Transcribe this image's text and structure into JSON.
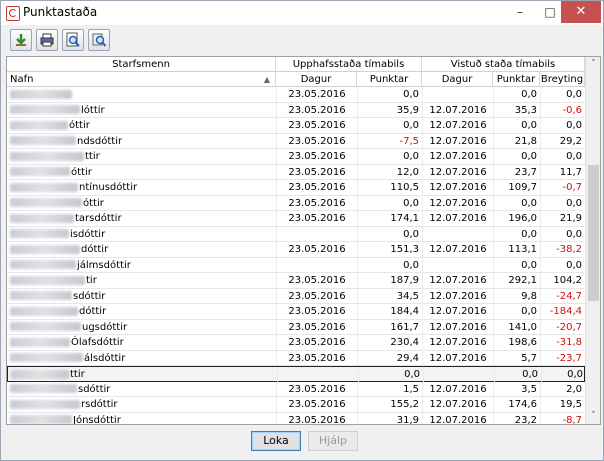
{
  "window": {
    "title": "Punktastaða"
  },
  "toolbar": {
    "tools": [
      {
        "name": "download-tool",
        "icon": "download-arrow-icon"
      },
      {
        "name": "print-tool",
        "icon": "printer-icon"
      },
      {
        "name": "preview-tool",
        "icon": "magnifier-page-icon"
      },
      {
        "name": "search-tool",
        "icon": "magnifier-icon"
      }
    ]
  },
  "grid": {
    "group_headers": {
      "staff": "Starfsmenn",
      "initial": "Upphafsstaða tímabils",
      "computed": "Vistuð staða tímabils"
    },
    "columns": {
      "name": "Nafn",
      "date1": "Dagur",
      "points1": "Punktar",
      "date2": "Dagur",
      "points2": "Punktar",
      "change": "Breyting"
    },
    "rows": [
      {
        "name": "",
        "d1": "23.05.2016",
        "p1": "0,0",
        "d2": "",
        "p2": "0,0",
        "b": "0,0"
      },
      {
        "name": "lóttir",
        "d1": "23.05.2016",
        "p1": "35,9",
        "d2": "12.07.2016",
        "p2": "35,3",
        "b": "-0,6"
      },
      {
        "name": "óttir",
        "d1": "23.05.2016",
        "p1": "0,0",
        "d2": "12.07.2016",
        "p2": "0,0",
        "b": "0,0"
      },
      {
        "name": "ndsdóttir",
        "d1": "23.05.2016",
        "p1": "-7,5",
        "d2": "12.07.2016",
        "p2": "21,8",
        "b": "29,2"
      },
      {
        "name": "ttir",
        "d1": "23.05.2016",
        "p1": "0,0",
        "d2": "12.07.2016",
        "p2": "0,0",
        "b": "0,0"
      },
      {
        "name": "óttir",
        "d1": "23.05.2016",
        "p1": "12,0",
        "d2": "12.07.2016",
        "p2": "23,7",
        "b": "11,7"
      },
      {
        "name": "ntínusdóttir",
        "d1": "23.05.2016",
        "p1": "110,5",
        "d2": "12.07.2016",
        "p2": "109,7",
        "b": "-0,7"
      },
      {
        "name": "óttir",
        "d1": "23.05.2016",
        "p1": "0,0",
        "d2": "12.07.2016",
        "p2": "0,0",
        "b": "0,0"
      },
      {
        "name": "tarsdóttir",
        "d1": "23.05.2016",
        "p1": "174,1",
        "d2": "12.07.2016",
        "p2": "196,0",
        "b": "21,9"
      },
      {
        "name": "isdóttir",
        "d1": "",
        "p1": "0,0",
        "d2": "",
        "p2": "0,0",
        "b": "0,0"
      },
      {
        "name": "dóttir",
        "d1": "23.05.2016",
        "p1": "151,3",
        "d2": "12.07.2016",
        "p2": "113,1",
        "b": "-38,2"
      },
      {
        "name": "jálmsdóttir",
        "d1": "",
        "p1": "0,0",
        "d2": "",
        "p2": "0,0",
        "b": "0,0"
      },
      {
        "name": "tir",
        "d1": "23.05.2016",
        "p1": "187,9",
        "d2": "12.07.2016",
        "p2": "292,1",
        "b": "104,2"
      },
      {
        "name": "sdóttir",
        "d1": "23.05.2016",
        "p1": "34,5",
        "d2": "12.07.2016",
        "p2": "9,8",
        "b": "-24,7"
      },
      {
        "name": "dóttir",
        "d1": "23.05.2016",
        "p1": "184,4",
        "d2": "12.07.2016",
        "p2": "0,0",
        "b": "-184,4"
      },
      {
        "name": "ugsdóttir",
        "d1": "23.05.2016",
        "p1": "161,7",
        "d2": "12.07.2016",
        "p2": "141,0",
        "b": "-20,7"
      },
      {
        "name": "Ólafsdóttir",
        "d1": "23.05.2016",
        "p1": "230,4",
        "d2": "12.07.2016",
        "p2": "198,6",
        "b": "-31,8"
      },
      {
        "name": "álsdóttir",
        "d1": "23.05.2016",
        "p1": "29,4",
        "d2": "12.07.2016",
        "p2": "5,7",
        "b": "-23,7"
      },
      {
        "name": "ttir",
        "d1": "",
        "p1": "0,0",
        "d2": "",
        "p2": "0,0",
        "b": "0,0"
      },
      {
        "name": "sdóttir",
        "d1": "23.05.2016",
        "p1": "1,5",
        "d2": "12.07.2016",
        "p2": "3,5",
        "b": "2,0"
      },
      {
        "name": "rsdóttir",
        "d1": "23.05.2016",
        "p1": "155,2",
        "d2": "12.07.2016",
        "p2": "174,6",
        "b": "19,5"
      },
      {
        "name": "Jónsdóttir",
        "d1": "23.05.2016",
        "p1": "31,9",
        "d2": "12.07.2016",
        "p2": "23,2",
        "b": "-8,7"
      }
    ]
  },
  "buttons": {
    "close": "Loka",
    "help": "Hjálp"
  },
  "colors": {
    "negative": "#d01010",
    "close_button": "#c75050"
  }
}
